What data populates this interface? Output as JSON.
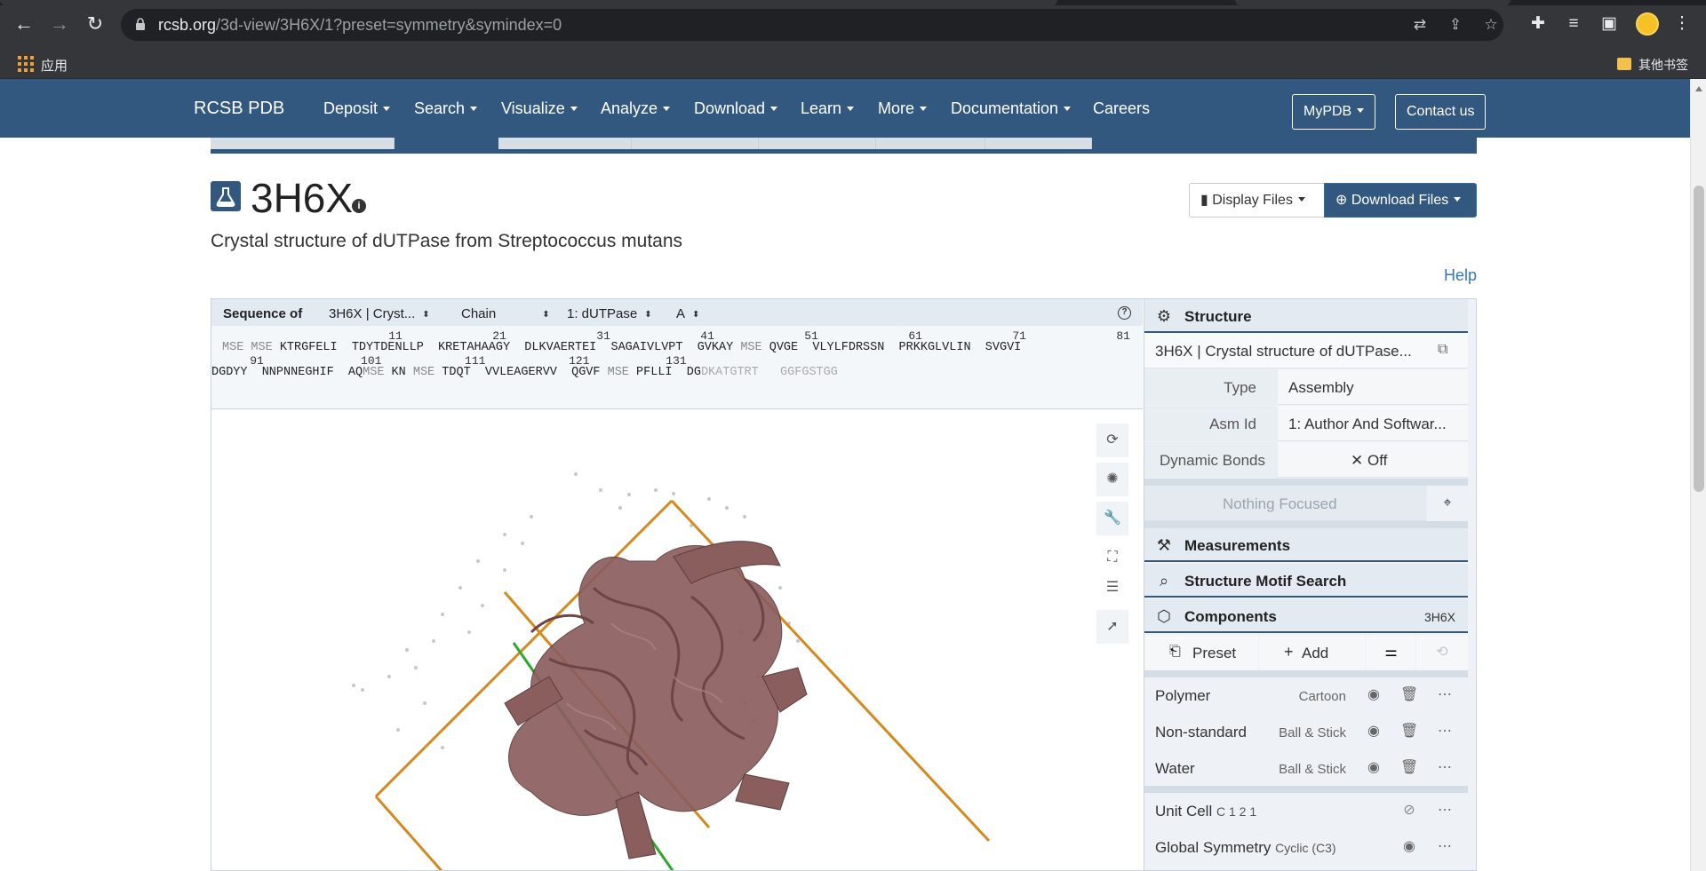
{
  "browser": {
    "url_host": "rcsb.org",
    "url_path": "/3d-view/3H6X/1?preset=symmetry&symindex=0",
    "bookmark_apps_label": "应用",
    "bookmark_other_label": "其他书签"
  },
  "navbar": {
    "brand": "RCSB PDB",
    "items": [
      "Deposit",
      "Search",
      "Visualize",
      "Analyze",
      "Download",
      "Learn",
      "More",
      "Documentation",
      "Careers"
    ],
    "mypdb_label": "MyPDB",
    "contact_label": "Contact us"
  },
  "entry": {
    "id": "3H6X",
    "title": "Crystal structure of dUTPase from Streptococcus mutans",
    "display_files_label": "Display Files",
    "download_files_label": "Download Files",
    "help_label": "Help"
  },
  "sequence": {
    "label": "Sequence of",
    "entry_select": "3H6X | Cryst...",
    "chain_select": "Chain",
    "entity_select": "1: dUTPase",
    "chain_id_select": "A",
    "line1_numbers": "                        11             21             31             41             51             61             71             81",
    "line1_mod": "MSE MSE",
    "line1_seq": " KTRGFELI  TDYTDENLLP  KRETAHAAGY  DLKVAERTEI  SAGAIVLVPT  GVKAY",
    "line1_mod2": "MSE",
    "line1_seq2": " QVGE  VLYLFDRSSN  PRKKGLVLIN  SVGVI",
    "line2_numbers": "    91              101            111            121           131",
    "line2_seq": "DGDYY  NNPNNEGHIF  AQ",
    "line2_mod": "MSE",
    "line2_seq_b": " KN ",
    "line2_mod2": "MSE",
    "line2_seq_c": " TDQT  VVLEAGERVV  QGVF ",
    "line2_mod3": "MSE",
    "line2_seq_d": " PFLLI  DG",
    "line2_light": "DKATGTRT   GGFGSTGG"
  },
  "panel": {
    "structure_title": "Structure",
    "structure_name": "3H6X | Crystal structure of dUTPase...",
    "type_key": "Type",
    "type_value": "Assembly",
    "asm_key": "Asm Id",
    "asm_value": "1: Author And Softwar...",
    "bonds_key": "Dynamic Bonds",
    "bonds_value": "Off",
    "focus_label": "Nothing Focused",
    "measurements_title": "Measurements",
    "motif_title": "Structure Motif Search",
    "components_title": "Components",
    "components_id": "3H6X",
    "preset_label": "Preset",
    "add_label": "Add",
    "components": [
      {
        "name": "Polymer",
        "rep": "Cartoon"
      },
      {
        "name": "Non-standard",
        "rep": "Ball & Stick"
      },
      {
        "name": "Water",
        "rep": "Ball & Stick"
      }
    ],
    "unit_cell_name": "Unit Cell",
    "unit_cell_group": "C 1 2 1",
    "symmetry_name": "Global Symmetry",
    "symmetry_group": "Cyclic (C3)"
  },
  "colors": {
    "nav": "#325880",
    "protein": "#8b5e5e",
    "cell": "#d48a1c",
    "axis": "#2da82d"
  }
}
